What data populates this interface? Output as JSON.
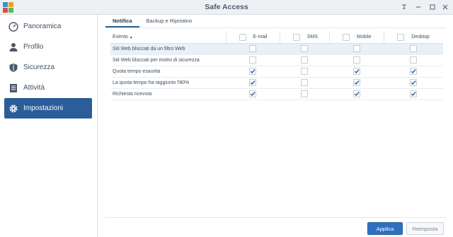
{
  "window": {
    "title": "Safe Access",
    "controls": [
      "pin-icon",
      "minimize-icon",
      "maximize-icon",
      "close-icon"
    ]
  },
  "sidebar": {
    "items": [
      {
        "label": "Panoramica",
        "icon": "speedometer-icon"
      },
      {
        "label": "Profilo",
        "icon": "person-icon"
      },
      {
        "label": "Sicurezza",
        "icon": "shield-icon"
      },
      {
        "label": "Attività",
        "icon": "log-icon"
      },
      {
        "label": "Impostazioni",
        "icon": "gear-icon",
        "active": true
      }
    ]
  },
  "tabs": [
    {
      "label": "Notifica",
      "active": true
    },
    {
      "label": "Backup e Ripristino",
      "active": false
    }
  ],
  "table": {
    "event_header": "Evento",
    "columns": [
      "E-mail",
      "SMS",
      "Mobile",
      "Desktop"
    ],
    "rows": [
      {
        "event": "Siti Web bloccati da un filtro Web",
        "values": [
          false,
          false,
          false,
          false
        ]
      },
      {
        "event": "Siti Web bloccati per motivi di sicurezza",
        "values": [
          false,
          false,
          false,
          false
        ]
      },
      {
        "event": "Quota tempo esaurita",
        "values": [
          true,
          false,
          true,
          true
        ]
      },
      {
        "event": "La quota tempo ha raggiunto l'80%",
        "values": [
          true,
          false,
          true,
          true
        ]
      },
      {
        "event": "Richiesta ricevuta",
        "values": [
          true,
          false,
          true,
          true
        ]
      }
    ]
  },
  "buttons": {
    "apply": "Applica",
    "reset": "Reimposta"
  },
  "colors": {
    "accent": "#2b5d99",
    "primary_button": "#2f6fbf",
    "check": "#2b5d99"
  }
}
